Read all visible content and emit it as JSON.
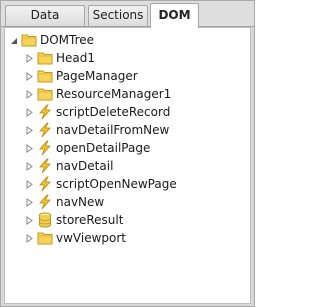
{
  "tabs": [
    {
      "label": "Data Sources",
      "active": false
    },
    {
      "label": "Sections",
      "active": false
    },
    {
      "label": "DOM",
      "active": true
    }
  ],
  "tree": {
    "root": {
      "label": "DOMTree",
      "icon": "folder-icon",
      "expanded": true
    },
    "children": [
      {
        "label": "Head1",
        "icon": "folder-icon"
      },
      {
        "label": "PageManager",
        "icon": "folder-icon"
      },
      {
        "label": "ResourceManager1",
        "icon": "folder-icon"
      },
      {
        "label": "scriptDeleteRecord",
        "icon": "lightning-icon"
      },
      {
        "label": "navDetailFromNew",
        "icon": "lightning-icon"
      },
      {
        "label": "openDetailPage",
        "icon": "lightning-icon"
      },
      {
        "label": "navDetail",
        "icon": "lightning-icon"
      },
      {
        "label": "scriptOpenNewPage",
        "icon": "lightning-icon"
      },
      {
        "label": "navNew",
        "icon": "lightning-icon"
      },
      {
        "label": "storeResult",
        "icon": "database-icon"
      },
      {
        "label": "vwViewport",
        "icon": "folder-icon"
      }
    ]
  },
  "colors": {
    "folder_fill": "#f7d35a",
    "folder_stroke": "#c49a1a",
    "lightning_fill": "#f4c430",
    "database_fill": "#f2cf54"
  }
}
